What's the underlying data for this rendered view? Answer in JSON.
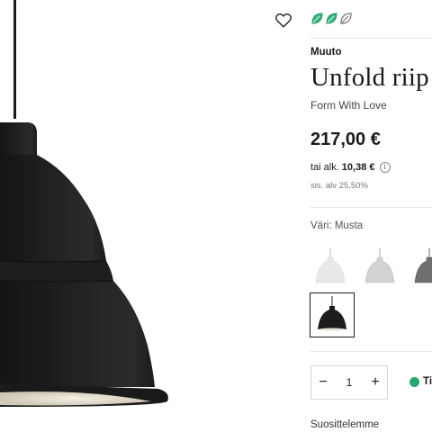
{
  "product": {
    "brand": "Muuto",
    "title": "Unfold riip",
    "designer": "Form With Love",
    "price": "217,00 €",
    "installment_prefix": "tai alk.",
    "installment_amount": "10,38 €",
    "vat": "sis. alv 25,50%"
  },
  "eco_rating": {
    "filled": 2,
    "total": 3,
    "color": "#2fb57a"
  },
  "variants": {
    "label": "Väri: Musta",
    "options": [
      {
        "name": "white",
        "color": "#e9e9e9",
        "selected": false
      },
      {
        "name": "light-grey",
        "color": "#d2d2d2",
        "selected": false
      },
      {
        "name": "dark-grey",
        "color": "#6f6f6f",
        "selected": false
      },
      {
        "name": "black",
        "color": "#1c1c1c",
        "selected": true
      }
    ]
  },
  "quantity": {
    "minus": "−",
    "value": "1",
    "plus": "+"
  },
  "stock": {
    "text": "Ti",
    "color": "#22a86b"
  },
  "recommendations": {
    "label": "Suosittelemme"
  },
  "icons": {
    "wishlist": "heart-icon",
    "eco": "leaf-icon",
    "info": "info-icon"
  }
}
